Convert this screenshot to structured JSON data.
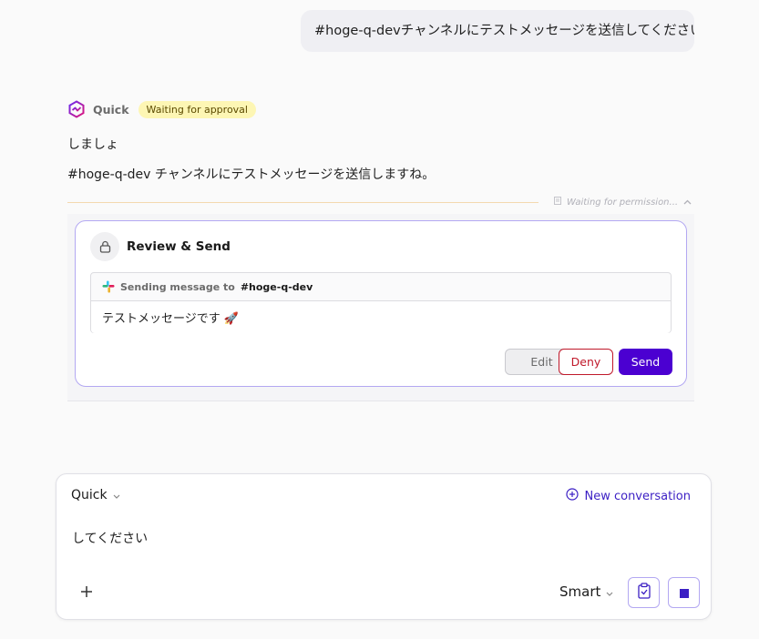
{
  "user_message": "#hoge-q-devチャンネルにテストメッセージを送信してください",
  "assistant": {
    "name": "Quick",
    "status_badge": "Waiting for approval",
    "lines": [
      "しましょ",
      "#hoge-q-dev チャンネルにテストメッセージを送信しますね。"
    ],
    "permission_status": "Waiting for permission..."
  },
  "review_card": {
    "title": "Review & Send",
    "sending_label": "Sending message to",
    "channel": "#hoge-q-dev",
    "message_body": "テストメッセージです 🚀",
    "buttons": {
      "edit": "Edit",
      "deny": "Deny",
      "send": "Send"
    }
  },
  "composer": {
    "agent": "Quick",
    "new_conversation": "New conversation",
    "prompt_text": "してください",
    "mode": "Smart"
  },
  "colors": {
    "accent": "#4b00d1",
    "deny": "#c0182a",
    "badge_bg": "#fdf6b4",
    "card_border": "#b3a8f2"
  },
  "icons": [
    "quick-logo-icon",
    "document-icon",
    "chevron-up-icon",
    "lock-icon",
    "slack-icon",
    "chevron-down-icon",
    "plus-circle-icon",
    "plus-icon",
    "clipboard-icon",
    "stop-icon"
  ]
}
